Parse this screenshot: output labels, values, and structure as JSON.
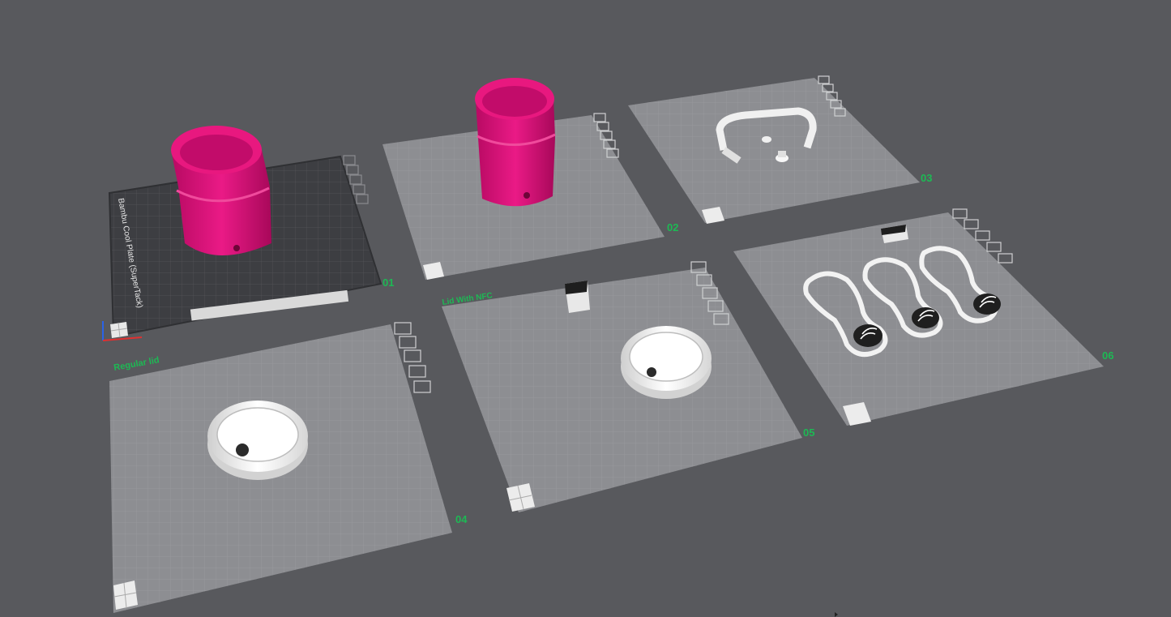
{
  "app": {
    "view": "Prepare – plate overview",
    "colors": {
      "background": "#58595d",
      "plate": "#8d8e92",
      "plate_dark": "#3d3e42",
      "accent_label": "#1db954",
      "magenta_filament": "#e0117b",
      "white_filament": "#f2f2f2"
    }
  },
  "plates": [
    {
      "id": "01",
      "number": "01",
      "name": "",
      "bed_text": "Bambu Cool Plate (SuperTack)",
      "selected": true
    },
    {
      "id": "02",
      "number": "02",
      "name": ""
    },
    {
      "id": "03",
      "number": "03",
      "name": ""
    },
    {
      "id": "04",
      "number": "04",
      "name": "Regular lid"
    },
    {
      "id": "05",
      "number": "05",
      "name": "Lid With NFC"
    },
    {
      "id": "06",
      "number": "06",
      "name": ""
    }
  ],
  "plate_toolbar": {
    "icons": [
      "close-icon",
      "arrange-icon",
      "orient-icon",
      "lock-icon",
      "settings-icon"
    ]
  }
}
